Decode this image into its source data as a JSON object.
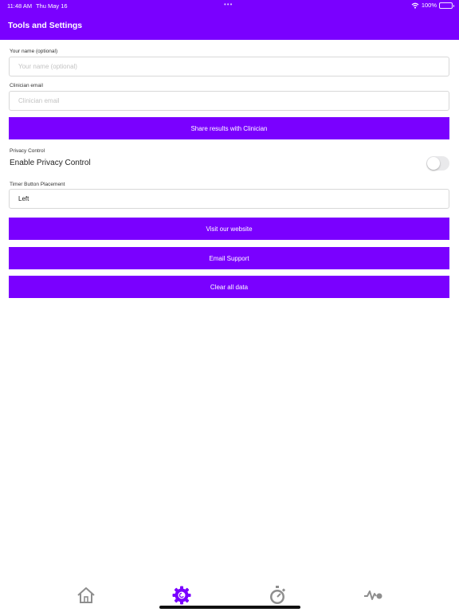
{
  "status_bar": {
    "time": "11:48 AM",
    "date": "Thu May 16",
    "battery": "100%"
  },
  "header": {
    "title": "Tools and Settings"
  },
  "form": {
    "name": {
      "label": "Your name (optional)",
      "placeholder": "Your name (optional)",
      "value": ""
    },
    "email": {
      "label": "Clinician email",
      "placeholder": "Clinician email",
      "value": ""
    },
    "share_button": "Share results with Clinician",
    "privacy": {
      "section_label": "Privacy Control",
      "toggle_label": "Enable Privacy Control",
      "enabled": false
    },
    "timer": {
      "label": "Timer Button Placement",
      "value": "Left"
    },
    "website_button": "Visit our website",
    "support_button": "Email Support",
    "clear_button": "Clear all data"
  },
  "tab_bar": {
    "active_color": "#7a00ff",
    "inactive_color": "#8e8e8e",
    "tabs": [
      {
        "icon": "home-icon",
        "active": false
      },
      {
        "icon": "gear-icon",
        "active": true
      },
      {
        "icon": "timer-icon",
        "active": false
      },
      {
        "icon": "activity-icon",
        "active": false
      }
    ]
  },
  "colors": {
    "accent": "#7a00ff",
    "background": "#ffffff"
  }
}
